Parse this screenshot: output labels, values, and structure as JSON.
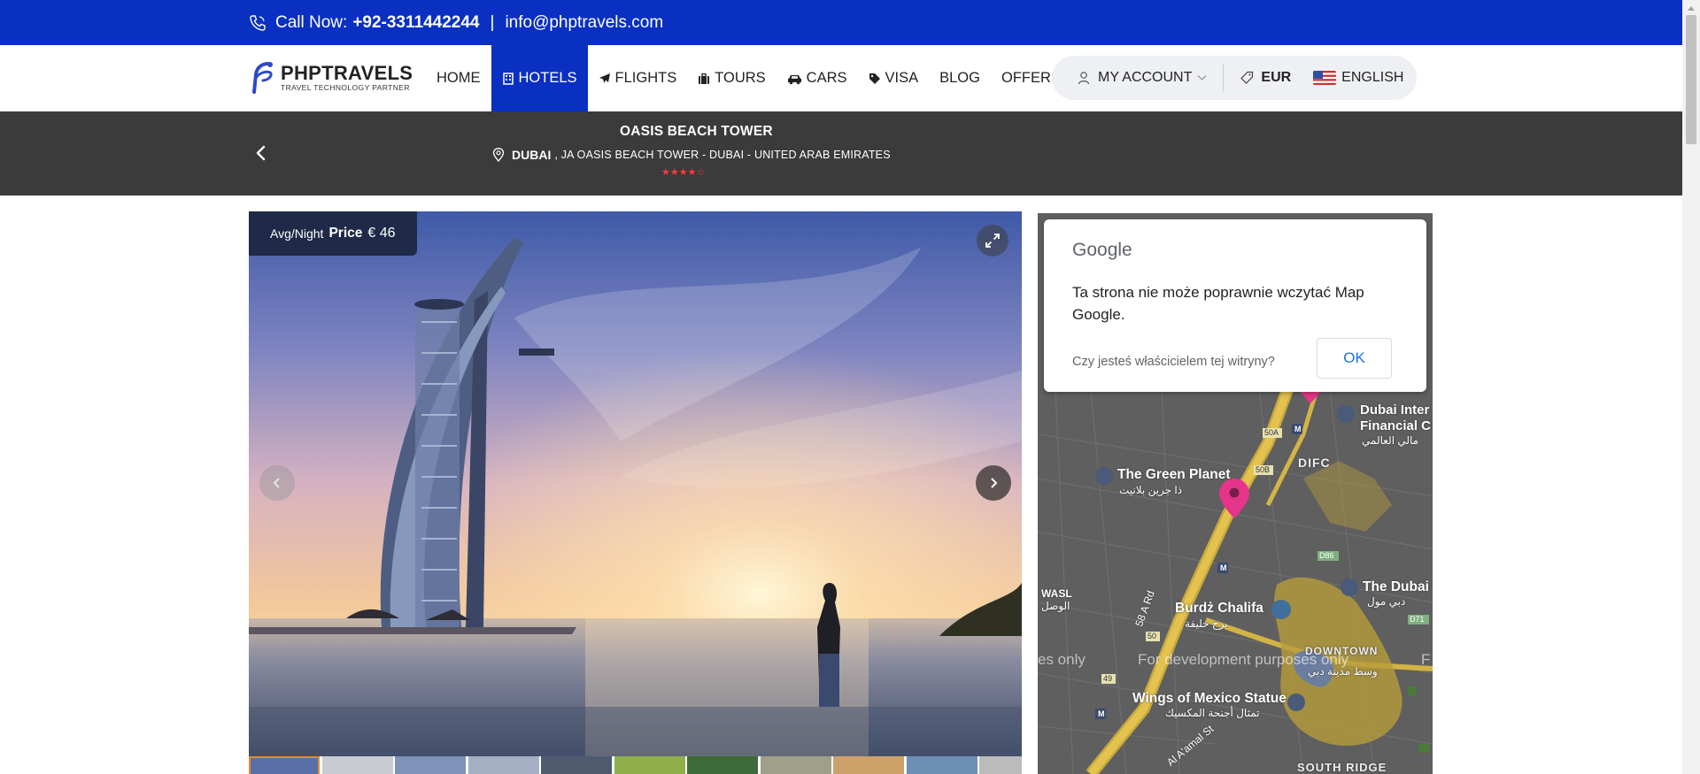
{
  "topbar": {
    "call_label": "Call Now:",
    "phone": "+92-3311442244",
    "separator": "|",
    "email": "info@phptravels.com"
  },
  "logo": {
    "title": "PHPTRAVELS",
    "subtitle": "TRAVEL TECHNOLOGY PARTNER"
  },
  "nav": {
    "items": [
      {
        "label": "HOME",
        "icon": ""
      },
      {
        "label": "HOTELS",
        "icon": "building-icon",
        "active": true
      },
      {
        "label": "FLIGHTS",
        "icon": "plane-icon"
      },
      {
        "label": "TOURS",
        "icon": "suitcase-icon"
      },
      {
        "label": "CARS",
        "icon": "car-icon"
      },
      {
        "label": "VISA",
        "icon": "tag-icon"
      },
      {
        "label": "BLOG",
        "icon": ""
      },
      {
        "label": "OFFERS",
        "icon": ""
      }
    ],
    "account": "MY ACCOUNT",
    "currency": "EUR",
    "language": "ENGLISH"
  },
  "hotel": {
    "name": "OASIS BEACH TOWER",
    "city": "DUBAI",
    "address": ", JA OASIS BEACH TOWER - DUBAI - UNITED ARAB EMIRATES",
    "rating": 4,
    "rating_max": 5
  },
  "gallery": {
    "avg_night": "Avg/Night",
    "price_label": "Price",
    "price_value": "€ 46",
    "thumbnail_count": 11
  },
  "map": {
    "dialog": {
      "brand": "Google",
      "message": "Ta strona nie może poprawnie wczytać Map Google.",
      "question": "Czy jesteś właścicielem tej witryny?",
      "ok": "OK"
    },
    "labels": {
      "green_planet": "The Green Planet",
      "green_planet_ar": "ذا جرين بلانيت",
      "difc": "DIFC",
      "dubai_intl": "Dubai Inter",
      "dubai_intl2": "Financial C",
      "dubai_intl_ar": "مالي العالمي",
      "burj": "Burdż Chalifa",
      "burj_ar": "برج خليفة",
      "downtown": "DOWNTOWN",
      "downtown_ar": "وسط مدينة دبي",
      "the_dubai": "The Dubai",
      "the_dubai_ar": "دبي مول",
      "wasl": "WASL",
      "wasl_ar": "الوصل",
      "wings": "Wings of Mexico Statue",
      "wings_ar": "تمثال أجنحة المكسيك",
      "south_ridge": "SOUTH RIDGE",
      "road_58a": "58 A Rd",
      "road_alamal": "Al A'amal St",
      "exit_50a": "50A",
      "exit_50b": "50B",
      "exit_50": "50",
      "exit_49": "49",
      "d86": "D86",
      "d71": "D71",
      "watermark_left": "es only",
      "watermark_center": "For development purposes only",
      "watermark_right": "F"
    }
  },
  "colors": {
    "brand_blue": "#0a30c2",
    "header_dark": "#3b3b3b",
    "star_red": "#ff3b3b",
    "price_badge": "#1e2a47",
    "google_blue": "#1a73e8",
    "pin_pink": "#e5358a"
  }
}
